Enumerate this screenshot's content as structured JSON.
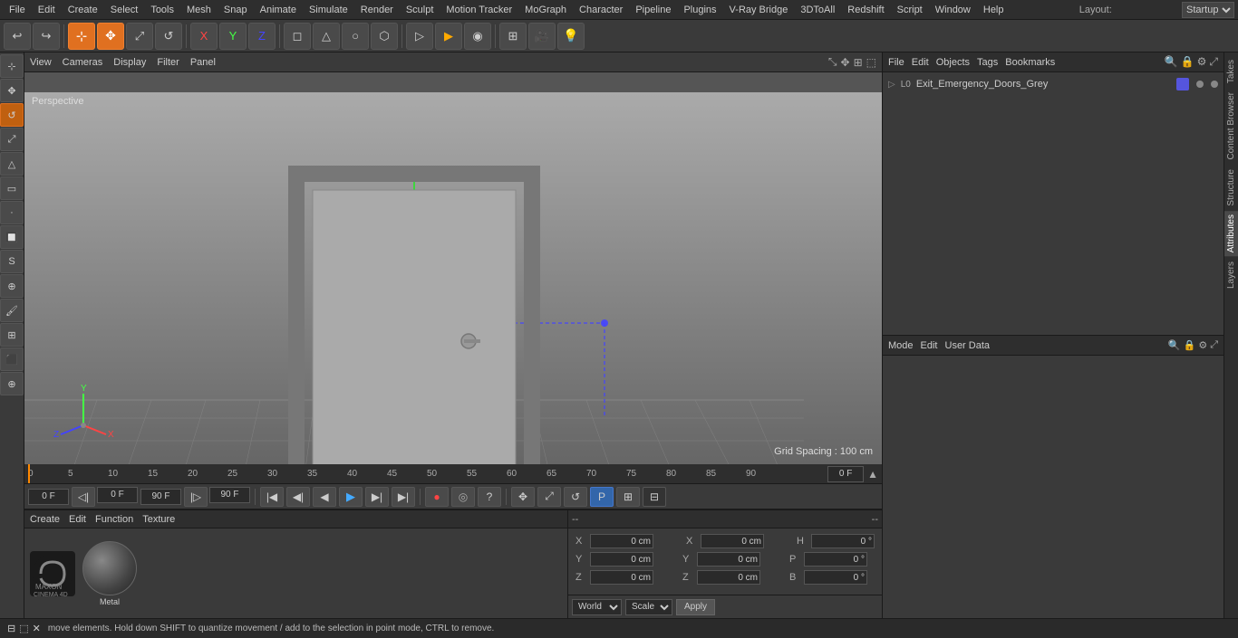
{
  "app": {
    "title": "Cinema 4D"
  },
  "menubar": {
    "items": [
      "File",
      "Edit",
      "Create",
      "Select",
      "Tools",
      "Mesh",
      "Snap",
      "Animate",
      "Simulate",
      "Render",
      "Sculpt",
      "Motion Tracker",
      "MoGraph",
      "Character",
      "Pipeline",
      "Plugins",
      "V-Ray Bridge",
      "3DToAll",
      "Redshift",
      "Script",
      "Window",
      "Help"
    ],
    "layout_label": "Layout:",
    "layout_value": "Startup"
  },
  "toolbar": {
    "undo_label": "↩",
    "tools": [
      "↩",
      "⬚",
      "⊕",
      "✥",
      "↺",
      "✚",
      "X",
      "Y",
      "Z",
      "◻",
      "↻",
      "⊕",
      "▦",
      "▷",
      "⬡",
      "⊙",
      "▦",
      "⬟",
      "◻",
      "☰",
      "◉"
    ]
  },
  "viewport": {
    "view_label": "View",
    "cameras_label": "Cameras",
    "display_label": "Display",
    "filter_label": "Filter",
    "panel_label": "Panel",
    "perspective_label": "Perspective",
    "grid_spacing": "Grid Spacing : 100 cm"
  },
  "objects_panel": {
    "header_items": [
      "File",
      "Edit",
      "Objects",
      "Tags",
      "Bookmarks"
    ],
    "objects": [
      {
        "name": "Exit_Emergency_Doors_Grey",
        "icon": "L0",
        "color": "blue"
      }
    ]
  },
  "attributes_panel": {
    "header_items": [
      "Mode",
      "Edit",
      "User Data"
    ],
    "coord_labels": {
      "x": "X",
      "y": "Y",
      "z": "Z",
      "h": "H",
      "p": "P",
      "b": "B",
      "x2": "X",
      "y2": "Y",
      "z2": "Z"
    },
    "coord_values": {
      "x": "0 cm",
      "y": "0 cm",
      "z": "0 cm",
      "x2": "0 cm",
      "y2": "0 cm",
      "z2": "0 cm",
      "h": "0 °",
      "p": "0 °",
      "b": "0 °"
    },
    "world_label": "World",
    "scale_label": "Scale",
    "apply_label": "Apply"
  },
  "timeline": {
    "start_frame": "0 F",
    "end_frame": "90 F",
    "current_frame": "0 F",
    "preview_start": "0 F",
    "preview_end": "90 F",
    "ticks": [
      "0",
      "5",
      "10",
      "15",
      "20",
      "25",
      "30",
      "35",
      "40",
      "45",
      "50",
      "55",
      "60",
      "65",
      "70",
      "75",
      "80",
      "85",
      "90"
    ]
  },
  "material": {
    "create_label": "Create",
    "edit_label": "Edit",
    "function_label": "Function",
    "texture_label": "Texture",
    "name": "Metal"
  },
  "right_tabs": {
    "tabs": [
      "Takes",
      "Content Browser",
      "Structure",
      "Attributes",
      "Layers"
    ]
  },
  "status": {
    "message": "move elements. Hold down SHIFT to quantize movement / add to the selection in point mode, CTRL to remove."
  },
  "coords_dashes": {
    "left": "--",
    "right": "--"
  }
}
